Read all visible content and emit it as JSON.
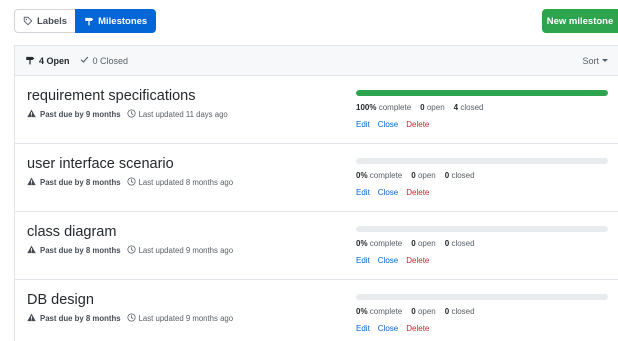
{
  "toolbar": {
    "labels_tab": "Labels",
    "milestones_tab": "Milestones",
    "new_milestone": "New milestone"
  },
  "list_header": {
    "open_count": "4 Open",
    "closed_count": "0 Closed",
    "sort_label": "Sort"
  },
  "milestones": [
    {
      "title": "requirement specifications",
      "due": "Past due by 9 months",
      "updated": "Last updated 11 days ago",
      "progress": 1.0,
      "complete": "100%",
      "complete_word": "complete",
      "open": "0",
      "open_word": "open",
      "closed": "4",
      "closed_word": "closed"
    },
    {
      "title": "user interface scenario",
      "due": "Past due by 8 months",
      "updated": "Last updated 8 months ago",
      "progress": 0.0,
      "complete": "0%",
      "complete_word": "complete",
      "open": "0",
      "open_word": "open",
      "closed": "0",
      "closed_word": "closed"
    },
    {
      "title": "class diagram",
      "due": "Past due by 8 months",
      "updated": "Last updated 9 months ago",
      "progress": 0.0,
      "complete": "0%",
      "complete_word": "complete",
      "open": "0",
      "open_word": "open",
      "closed": "0",
      "closed_word": "closed"
    },
    {
      "title": "DB design",
      "due": "Past due by 8 months",
      "updated": "Last updated 9 months ago",
      "progress": 0.0,
      "complete": "0%",
      "complete_word": "complete",
      "open": "0",
      "open_word": "open",
      "closed": "0",
      "closed_word": "closed"
    }
  ],
  "actions": {
    "edit": "Edit",
    "close": "Close",
    "delete": "Delete"
  },
  "colors": {
    "accent_blue": "#0366d6",
    "success_green": "#2ea44f",
    "danger_red": "#cb2431"
  },
  "icons": {
    "labels_tab": "tag-icon",
    "milestones_tab": "milestone-icon",
    "closed": "check-icon",
    "due": "alert-icon",
    "updated": "clock-icon"
  }
}
